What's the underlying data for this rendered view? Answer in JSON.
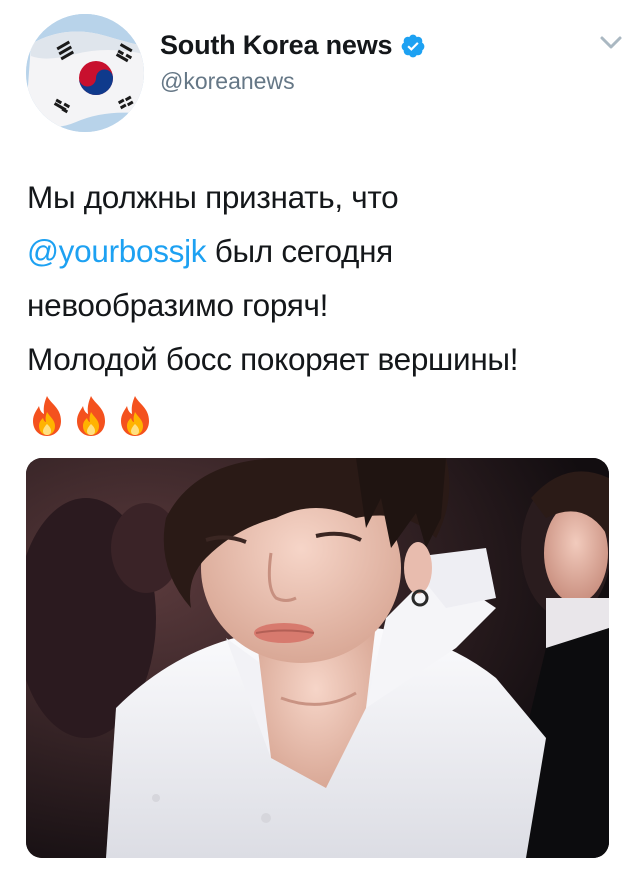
{
  "tweet": {
    "author": {
      "display_name": "South Korea news",
      "handle": "@koreanews",
      "verified": true,
      "avatar_icon": "south-korea-flag-avatar"
    },
    "menu_icon": "chevron-down-icon",
    "text": {
      "line1": "Мы должны признать, что",
      "mention": "@yourbossjk",
      "line2_rest": " был сегодня",
      "line3": "невообразимо горяч!",
      "line4": "Молодой босс покоряет вершины!",
      "emoji": [
        "fire-emoji",
        "fire-emoji",
        "fire-emoji"
      ]
    },
    "media": {
      "icon": "photo-attachment"
    }
  },
  "colors": {
    "text": "#14171a",
    "secondary": "#657786",
    "link": "#1da1f2",
    "verified": "#1da1f2"
  }
}
